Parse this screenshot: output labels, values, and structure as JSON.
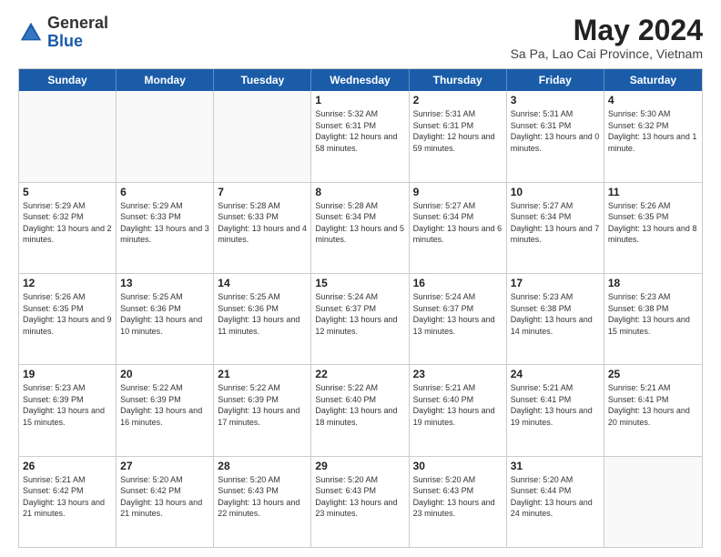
{
  "header": {
    "logo_general": "General",
    "logo_blue": "Blue",
    "month_year": "May 2024",
    "location": "Sa Pa, Lao Cai Province, Vietnam"
  },
  "weekdays": [
    "Sunday",
    "Monday",
    "Tuesday",
    "Wednesday",
    "Thursday",
    "Friday",
    "Saturday"
  ],
  "rows": [
    [
      {
        "day": "",
        "empty": true
      },
      {
        "day": "",
        "empty": true
      },
      {
        "day": "",
        "empty": true
      },
      {
        "day": "1",
        "sunrise": "5:32 AM",
        "sunset": "6:31 PM",
        "daylight": "12 hours and 58 minutes."
      },
      {
        "day": "2",
        "sunrise": "5:31 AM",
        "sunset": "6:31 PM",
        "daylight": "12 hours and 59 minutes."
      },
      {
        "day": "3",
        "sunrise": "5:31 AM",
        "sunset": "6:31 PM",
        "daylight": "13 hours and 0 minutes."
      },
      {
        "day": "4",
        "sunrise": "5:30 AM",
        "sunset": "6:32 PM",
        "daylight": "13 hours and 1 minute."
      }
    ],
    [
      {
        "day": "5",
        "sunrise": "5:29 AM",
        "sunset": "6:32 PM",
        "daylight": "13 hours and 2 minutes."
      },
      {
        "day": "6",
        "sunrise": "5:29 AM",
        "sunset": "6:33 PM",
        "daylight": "13 hours and 3 minutes."
      },
      {
        "day": "7",
        "sunrise": "5:28 AM",
        "sunset": "6:33 PM",
        "daylight": "13 hours and 4 minutes."
      },
      {
        "day": "8",
        "sunrise": "5:28 AM",
        "sunset": "6:34 PM",
        "daylight": "13 hours and 5 minutes."
      },
      {
        "day": "9",
        "sunrise": "5:27 AM",
        "sunset": "6:34 PM",
        "daylight": "13 hours and 6 minutes."
      },
      {
        "day": "10",
        "sunrise": "5:27 AM",
        "sunset": "6:34 PM",
        "daylight": "13 hours and 7 minutes."
      },
      {
        "day": "11",
        "sunrise": "5:26 AM",
        "sunset": "6:35 PM",
        "daylight": "13 hours and 8 minutes."
      }
    ],
    [
      {
        "day": "12",
        "sunrise": "5:26 AM",
        "sunset": "6:35 PM",
        "daylight": "13 hours and 9 minutes."
      },
      {
        "day": "13",
        "sunrise": "5:25 AM",
        "sunset": "6:36 PM",
        "daylight": "13 hours and 10 minutes."
      },
      {
        "day": "14",
        "sunrise": "5:25 AM",
        "sunset": "6:36 PM",
        "daylight": "13 hours and 11 minutes."
      },
      {
        "day": "15",
        "sunrise": "5:24 AM",
        "sunset": "6:37 PM",
        "daylight": "13 hours and 12 minutes."
      },
      {
        "day": "16",
        "sunrise": "5:24 AM",
        "sunset": "6:37 PM",
        "daylight": "13 hours and 13 minutes."
      },
      {
        "day": "17",
        "sunrise": "5:23 AM",
        "sunset": "6:38 PM",
        "daylight": "13 hours and 14 minutes."
      },
      {
        "day": "18",
        "sunrise": "5:23 AM",
        "sunset": "6:38 PM",
        "daylight": "13 hours and 15 minutes."
      }
    ],
    [
      {
        "day": "19",
        "sunrise": "5:23 AM",
        "sunset": "6:39 PM",
        "daylight": "13 hours and 15 minutes."
      },
      {
        "day": "20",
        "sunrise": "5:22 AM",
        "sunset": "6:39 PM",
        "daylight": "13 hours and 16 minutes."
      },
      {
        "day": "21",
        "sunrise": "5:22 AM",
        "sunset": "6:39 PM",
        "daylight": "13 hours and 17 minutes."
      },
      {
        "day": "22",
        "sunrise": "5:22 AM",
        "sunset": "6:40 PM",
        "daylight": "13 hours and 18 minutes."
      },
      {
        "day": "23",
        "sunrise": "5:21 AM",
        "sunset": "6:40 PM",
        "daylight": "13 hours and 19 minutes."
      },
      {
        "day": "24",
        "sunrise": "5:21 AM",
        "sunset": "6:41 PM",
        "daylight": "13 hours and 19 minutes."
      },
      {
        "day": "25",
        "sunrise": "5:21 AM",
        "sunset": "6:41 PM",
        "daylight": "13 hours and 20 minutes."
      }
    ],
    [
      {
        "day": "26",
        "sunrise": "5:21 AM",
        "sunset": "6:42 PM",
        "daylight": "13 hours and 21 minutes."
      },
      {
        "day": "27",
        "sunrise": "5:20 AM",
        "sunset": "6:42 PM",
        "daylight": "13 hours and 21 minutes."
      },
      {
        "day": "28",
        "sunrise": "5:20 AM",
        "sunset": "6:43 PM",
        "daylight": "13 hours and 22 minutes."
      },
      {
        "day": "29",
        "sunrise": "5:20 AM",
        "sunset": "6:43 PM",
        "daylight": "13 hours and 23 minutes."
      },
      {
        "day": "30",
        "sunrise": "5:20 AM",
        "sunset": "6:43 PM",
        "daylight": "13 hours and 23 minutes."
      },
      {
        "day": "31",
        "sunrise": "5:20 AM",
        "sunset": "6:44 PM",
        "daylight": "13 hours and 24 minutes."
      },
      {
        "day": "",
        "empty": true
      }
    ]
  ]
}
